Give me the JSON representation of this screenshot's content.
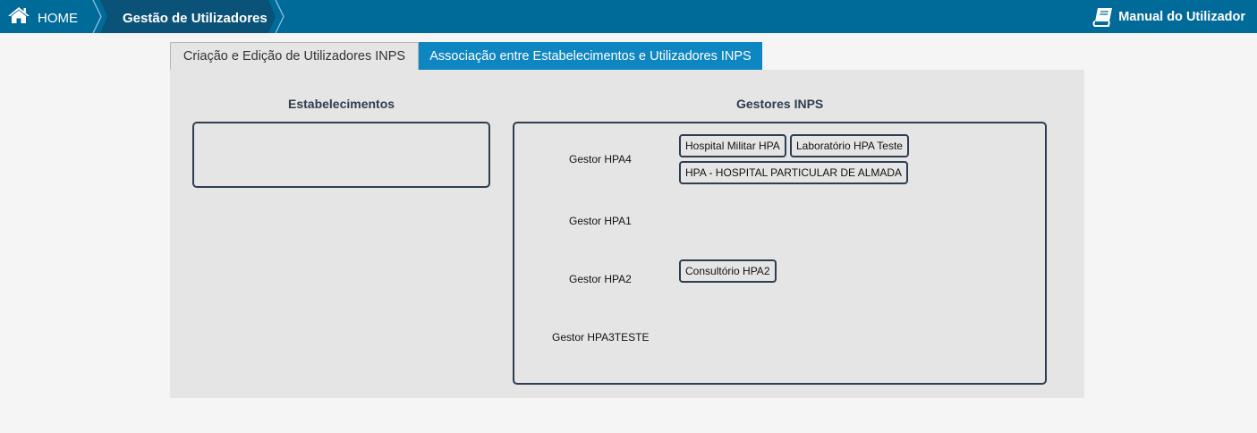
{
  "header": {
    "home_label": "HOME",
    "current_label": "Gestão de Utilizadores",
    "manual_label": "Manual do Utilizador",
    "home_icon": "home-icon",
    "manual_icon": "book-icon",
    "bar_color": "#006a99"
  },
  "tabs": [
    {
      "label": "Criação e Edição de Utilizadores INPS",
      "active": false
    },
    {
      "label": "Associação entre Estabelecimentos e Utilizadores INPS",
      "active": true
    }
  ],
  "main": {
    "establishments_title": "Estabelecimentos",
    "managers_title": "Gestores INPS",
    "managers": [
      {
        "name": "Gestor HPA4",
        "establishments": [
          "Hospital Militar HPA",
          "Laboratório HPA Teste",
          "HPA - HOSPITAL PARTICULAR DE ALMADA"
        ]
      },
      {
        "name": "Gestor HPA1",
        "establishments": []
      },
      {
        "name": "Gestor HPA2",
        "establishments": [
          "Consultório HPA2"
        ]
      },
      {
        "name": "Gestor HPA3TESTE",
        "establishments": []
      }
    ]
  }
}
